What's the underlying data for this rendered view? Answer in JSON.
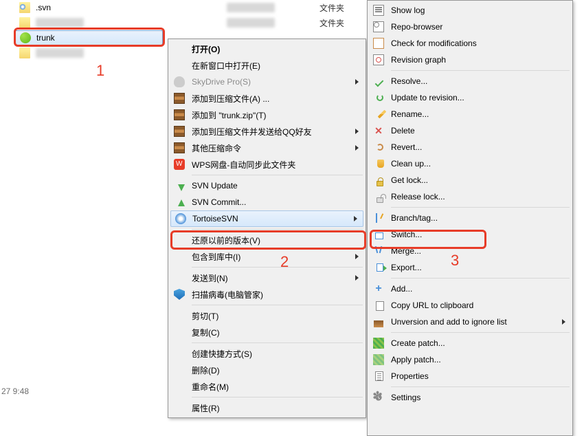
{
  "files": {
    "svn_folder": ".svn",
    "trunk": "trunk",
    "type_folder": "文件夹"
  },
  "timestamp": "27 9:48",
  "annot": {
    "n1": "1",
    "n2": "2",
    "n3": "3"
  },
  "menu1": {
    "open": "打开(O)",
    "open_new": "在新窗口中打开(E)",
    "skydrive": "SkyDrive Pro(S)",
    "add_archive": "添加到压缩文件(A) ...",
    "add_trunk_zip": "添加到 \"trunk.zip\"(T)",
    "add_send_qq": "添加到压缩文件并发送给QQ好友",
    "other_compress": "其他压缩命令",
    "wps": "WPS网盘-自动同步此文件夹",
    "svn_update": "SVN Update",
    "svn_commit": "SVN Commit...",
    "tortoise": "TortoiseSVN",
    "restore_prev": "还原以前的版本(V)",
    "include_lib": "包含到库中(I)",
    "send_to": "发送到(N)",
    "scan_virus": "扫描病毒(电脑管家)",
    "cut": "剪切(T)",
    "copy": "复制(C)",
    "create_shortcut": "创建快捷方式(S)",
    "delete": "删除(D)",
    "rename": "重命名(M)",
    "properties": "属性(R)"
  },
  "menu2": {
    "show_log": "Show log",
    "repo_browser": "Repo-browser",
    "check_mods": "Check for modifications",
    "rev_graph": "Revision graph",
    "resolve": "Resolve...",
    "update_rev": "Update to revision...",
    "rename": "Rename...",
    "delete": "Delete",
    "revert": "Revert...",
    "clean_up": "Clean up...",
    "get_lock": "Get lock...",
    "release_lock": "Release lock...",
    "branch_tag": "Branch/tag...",
    "switch": "Switch...",
    "merge": "Merge...",
    "export": "Export...",
    "add": "Add...",
    "copy_url": "Copy URL to clipboard",
    "unversion": "Unversion and add to ignore list",
    "create_patch": "Create patch...",
    "apply_patch": "Apply patch...",
    "properties": "Properties",
    "settings": "Settings"
  }
}
